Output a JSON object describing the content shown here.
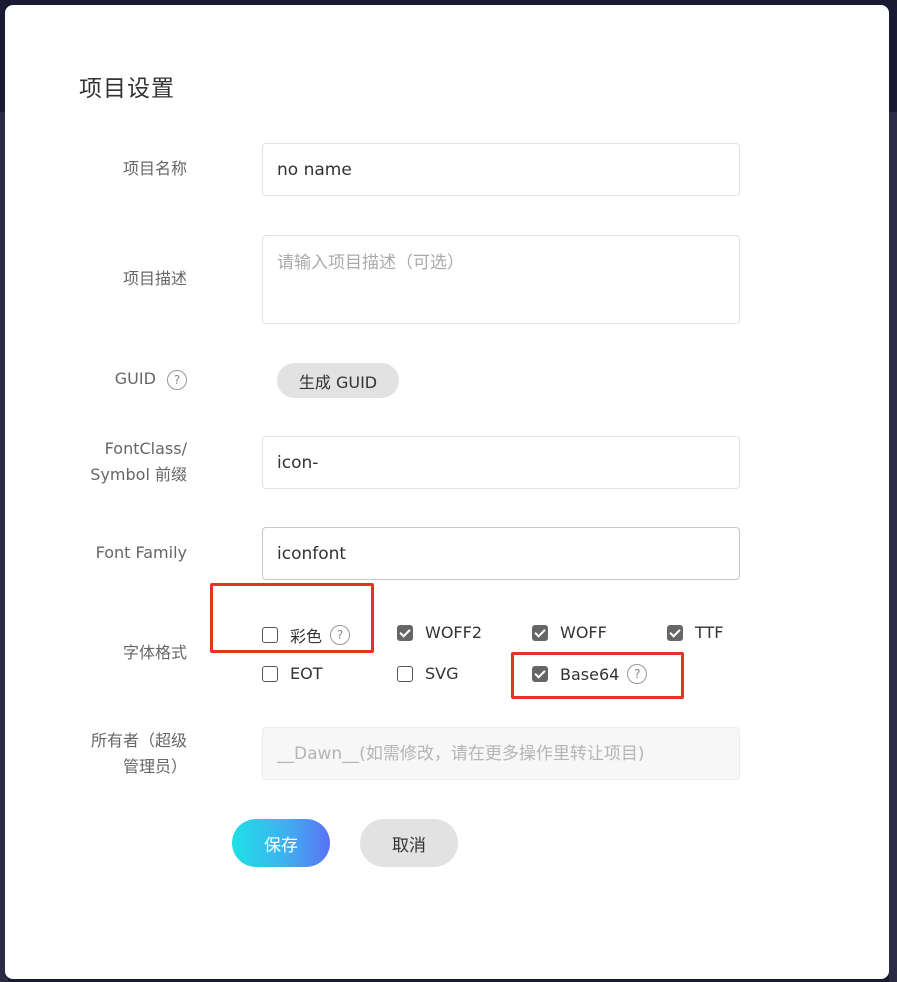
{
  "dialog": {
    "title": "项目设置",
    "name": {
      "label": "项目名称",
      "value": "no name"
    },
    "description": {
      "label": "项目描述",
      "placeholder": "请输入项目描述（可选）"
    },
    "guid": {
      "label": "GUID",
      "button": "生成 GUID"
    },
    "prefix": {
      "label_line1": "FontClass/",
      "label_line2": "Symbol 前缀",
      "value": "icon-"
    },
    "font_family": {
      "label": "Font Family",
      "value": "iconfont"
    },
    "formats": {
      "label": "字体格式",
      "options": [
        {
          "label": "彩色",
          "checked": false,
          "help": true
        },
        {
          "label": "WOFF2",
          "checked": true
        },
        {
          "label": "WOFF",
          "checked": true
        },
        {
          "label": "TTF",
          "checked": true
        },
        {
          "label": "EOT",
          "checked": false
        },
        {
          "label": "SVG",
          "checked": false
        },
        {
          "label": "Base64",
          "checked": true,
          "help": true
        }
      ]
    },
    "owner": {
      "label_line1": "所有者（超级",
      "label_line2": "管理员）",
      "placeholder": "__Dawn__(如需修改，请在更多操作里转让项目)"
    },
    "save_label": "保存",
    "cancel_label": "取消",
    "help_glyph": "?"
  },
  "colors": {
    "highlight": "#e53326",
    "accent_start": "#1fe0e6",
    "accent_end": "#5a72f5"
  }
}
